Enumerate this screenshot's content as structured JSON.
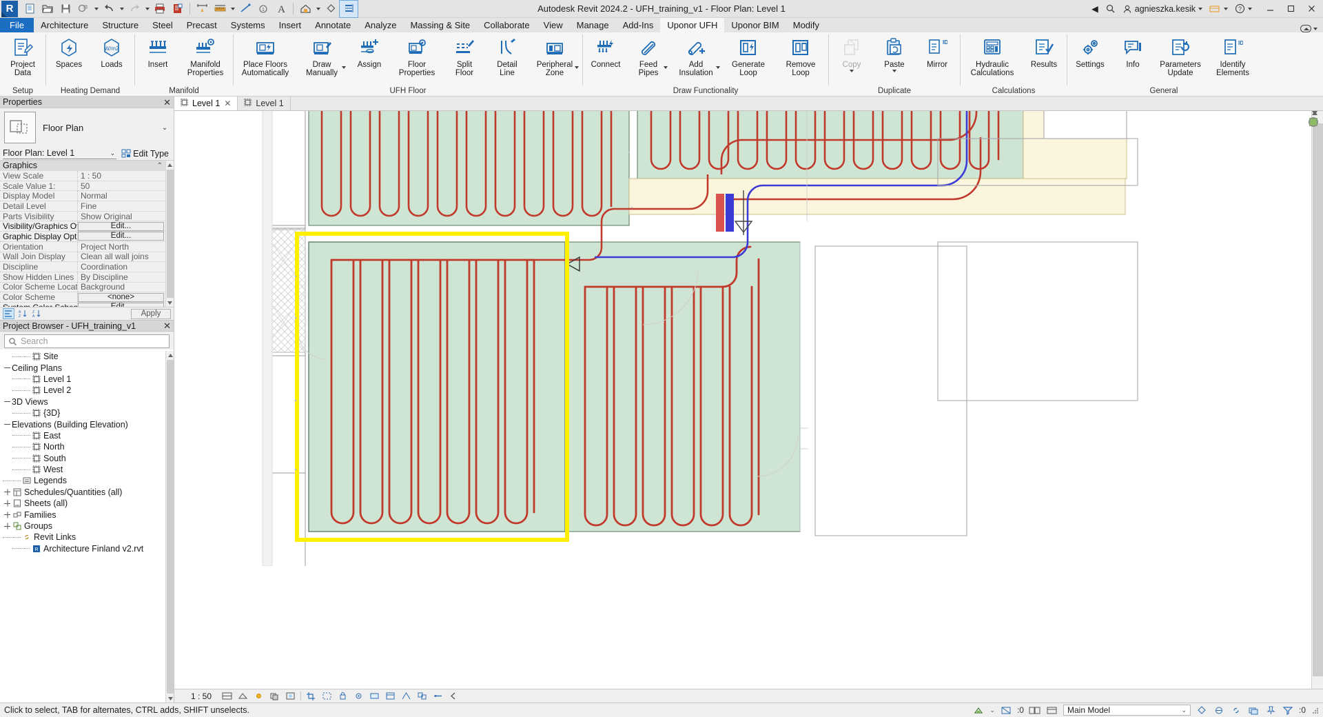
{
  "window": {
    "title": "Autodesk Revit 2024.2 - UFH_training_v1 - Floor Plan: Level 1",
    "user": "agnieszka.kesik",
    "minimize": "–",
    "maximize": "▭",
    "close": "✕"
  },
  "quick_access": {
    "logo": "R",
    "items": [
      "new-icon",
      "open-icon",
      "save-icon",
      "save-as-icon",
      "undo-icon",
      "redo-icon",
      "print-icon",
      "print-preview-icon",
      "measure-icon",
      "aligned-dimension-icon",
      "tag-icon",
      "keynote-icon",
      "text-icon",
      "default-3d-view-icon",
      "section-icon",
      "thin-lines-icon"
    ]
  },
  "tabs": {
    "file": "File",
    "items": [
      "Architecture",
      "Structure",
      "Steel",
      "Precast",
      "Systems",
      "Insert",
      "Annotate",
      "Analyze",
      "Massing & Site",
      "Collaborate",
      "View",
      "Manage",
      "Add-Ins",
      "Uponor UFH",
      "Uponor BIM",
      "Modify"
    ],
    "active": "Uponor UFH"
  },
  "ribbon": {
    "panels": [
      {
        "title": "Setup",
        "buttons": [
          {
            "label": "Project\nData",
            "icon": "project-data-icon",
            "dropdown": false,
            "disabled": false
          }
        ]
      },
      {
        "title": "Heating Demand",
        "buttons": [
          {
            "label": "Spaces",
            "icon": "spaces-icon",
            "dropdown": false,
            "disabled": false
          },
          {
            "label": "Loads",
            "icon": "loads-icon",
            "dropdown": false,
            "disabled": false
          }
        ]
      },
      {
        "title": "Manifold",
        "buttons": [
          {
            "label": "Insert",
            "icon": "insert-manifold-icon",
            "dropdown": false,
            "disabled": false
          },
          {
            "label": "Manifold\nProperties",
            "icon": "manifold-properties-icon",
            "dropdown": false,
            "disabled": false
          }
        ]
      },
      {
        "title": "UFH Floor",
        "buttons": [
          {
            "label": "Place Floors\nAutomatically",
            "icon": "place-floors-icon",
            "dropdown": false,
            "disabled": false
          },
          {
            "label": "Draw\nManually",
            "icon": "draw-manually-icon",
            "dropdown": true,
            "disabled": false
          },
          {
            "label": "Assign",
            "icon": "assign-icon",
            "dropdown": false,
            "disabled": false
          },
          {
            "label": "Floor\nProperties",
            "icon": "floor-properties-icon",
            "dropdown": false,
            "disabled": false
          },
          {
            "label": "Split\nFloor",
            "icon": "split-floor-icon",
            "dropdown": false,
            "disabled": false
          },
          {
            "label": "Detail\nLine",
            "icon": "detail-line-icon",
            "dropdown": false,
            "disabled": false
          },
          {
            "label": "Peripheral\nZone",
            "icon": "peripheral-zone-icon",
            "dropdown": true,
            "disabled": false
          }
        ]
      },
      {
        "title": "Draw Functionality",
        "buttons": [
          {
            "label": "Connect",
            "icon": "connect-icon",
            "dropdown": false,
            "disabled": false
          },
          {
            "label": "Feed\nPipes",
            "icon": "feed-pipes-icon",
            "dropdown": true,
            "disabled": false
          },
          {
            "label": "Add\nInsulation",
            "icon": "add-insulation-icon",
            "dropdown": true,
            "disabled": false
          },
          {
            "label": "Generate\nLoop",
            "icon": "generate-loop-icon",
            "dropdown": false,
            "disabled": false
          },
          {
            "label": "Remove\nLoop",
            "icon": "remove-loop-icon",
            "dropdown": false,
            "disabled": false
          }
        ]
      },
      {
        "title": "Duplicate",
        "buttons": [
          {
            "label": "Copy",
            "icon": "copy-icon",
            "dropdown": true,
            "disabled": true
          },
          {
            "label": "Paste",
            "icon": "paste-icon",
            "dropdown": true,
            "disabled": false
          },
          {
            "label": "Mirror",
            "icon": "mirror-icon",
            "dropdown": false,
            "disabled": false
          }
        ]
      },
      {
        "title": "Calculations",
        "buttons": [
          {
            "label": "Hydraulic\nCalculations",
            "icon": "hydraulic-calculations-icon",
            "dropdown": false,
            "disabled": false
          },
          {
            "label": "Results",
            "icon": "results-icon",
            "dropdown": false,
            "disabled": false
          }
        ]
      },
      {
        "title": "General",
        "buttons": [
          {
            "label": "Settings",
            "icon": "settings-icon",
            "dropdown": false,
            "disabled": false
          },
          {
            "label": "Info",
            "icon": "info-icon",
            "dropdown": false,
            "disabled": false
          },
          {
            "label": "Parameters\nUpdate",
            "icon": "parameters-update-icon",
            "dropdown": false,
            "disabled": false
          },
          {
            "label": "Identify\nElements",
            "icon": "identify-elements-icon",
            "dropdown": false,
            "disabled": false
          }
        ]
      }
    ]
  },
  "properties": {
    "header": "Properties",
    "type_name": "Floor Plan",
    "selector": "Floor Plan: Level 1",
    "edit_type": "Edit Type",
    "group": "Graphics",
    "rows": [
      {
        "key": "View Scale",
        "value": "1 : 50",
        "kind": "text",
        "bold": false
      },
      {
        "key": "Scale Value    1:",
        "value": "50",
        "kind": "text",
        "bold": false
      },
      {
        "key": "Display Model",
        "value": "Normal",
        "kind": "text",
        "bold": false
      },
      {
        "key": "Detail Level",
        "value": "Fine",
        "kind": "text",
        "bold": false
      },
      {
        "key": "Parts Visibility",
        "value": "Show Original",
        "kind": "text",
        "bold": false
      },
      {
        "key": "Visibility/Graphics Ove...",
        "value": "Edit...",
        "kind": "button",
        "bold": true
      },
      {
        "key": "Graphic Display Options",
        "value": "Edit...",
        "kind": "button",
        "bold": true
      },
      {
        "key": "Orientation",
        "value": "Project North",
        "kind": "text",
        "bold": false
      },
      {
        "key": "Wall Join Display",
        "value": "Clean all wall joins",
        "kind": "text",
        "bold": false
      },
      {
        "key": "Discipline",
        "value": "Coordination",
        "kind": "text",
        "bold": false
      },
      {
        "key": "Show Hidden Lines",
        "value": "By Discipline",
        "kind": "text",
        "bold": false
      },
      {
        "key": "Color Scheme Location",
        "value": "Background",
        "kind": "text",
        "bold": false
      },
      {
        "key": "Color Scheme",
        "value": "<none>",
        "kind": "button",
        "bold": false
      },
      {
        "key": "System Color Schemes",
        "value": "Edit...",
        "kind": "button",
        "bold": true
      }
    ],
    "apply": "Apply",
    "toolbar_icons": [
      "group-by-category-icon",
      "sort-ascending-icon",
      "sort-descending-icon"
    ]
  },
  "project_browser": {
    "header": "Project Browser - UFH_training_v1",
    "search_placeholder": "Search",
    "nodes": [
      {
        "label": "Site",
        "depth": 2,
        "toggle": "none",
        "icon": "view-icon"
      },
      {
        "label": "Ceiling Plans",
        "depth": 1,
        "toggle": "minus",
        "icon": "none"
      },
      {
        "label": "Level 1",
        "depth": 2,
        "toggle": "none",
        "icon": "view-icon"
      },
      {
        "label": "Level 2",
        "depth": 2,
        "toggle": "none",
        "icon": "view-icon"
      },
      {
        "label": "3D Views",
        "depth": 1,
        "toggle": "minus",
        "icon": "none"
      },
      {
        "label": "{3D}",
        "depth": 2,
        "toggle": "none",
        "icon": "view-icon"
      },
      {
        "label": "Elevations (Building Elevation)",
        "depth": 1,
        "toggle": "minus",
        "icon": "none"
      },
      {
        "label": "East",
        "depth": 2,
        "toggle": "none",
        "icon": "view-icon"
      },
      {
        "label": "North",
        "depth": 2,
        "toggle": "none",
        "icon": "view-icon"
      },
      {
        "label": "South",
        "depth": 2,
        "toggle": "none",
        "icon": "view-icon"
      },
      {
        "label": "West",
        "depth": 2,
        "toggle": "none",
        "icon": "view-icon"
      },
      {
        "label": "Legends",
        "depth": 1,
        "toggle": "none",
        "icon": "legend-icon"
      },
      {
        "label": "Schedules/Quantities (all)",
        "depth": 1,
        "toggle": "plus",
        "icon": "schedule-icon"
      },
      {
        "label": "Sheets (all)",
        "depth": 1,
        "toggle": "plus",
        "icon": "sheet-icon"
      },
      {
        "label": "Families",
        "depth": 1,
        "toggle": "plus",
        "icon": "family-icon"
      },
      {
        "label": "Groups",
        "depth": 1,
        "toggle": "plus",
        "icon": "group-icon"
      },
      {
        "label": "Revit Links",
        "depth": 1,
        "toggle": "none",
        "icon": "link-icon"
      },
      {
        "label": "Architecture Finland v2.rvt",
        "depth": 2,
        "toggle": "none",
        "icon": "rvt-icon"
      }
    ]
  },
  "view_tabs": [
    {
      "label": "Level 1",
      "active": true,
      "closable": true,
      "icon": "view-tab-icon"
    },
    {
      "label": "Level 1",
      "active": false,
      "closable": false,
      "icon": "view-tab-icon"
    }
  ],
  "view_control_bar": {
    "scale": "1 : 50",
    "icons": [
      "detail-level-icon",
      "visual-style-icon",
      "sun-path-icon",
      "shadows-icon",
      "render-icon",
      "crop-view-icon",
      "show-crop-icon",
      "lock-3d-view-icon",
      "temporary-hide-isolate-icon",
      "reveal-hidden-icon",
      "temporary-view-properties-icon",
      "show-analytical-model-icon",
      "highlight-displacement-sets-icon",
      "reveal-constraints-icon",
      "expand-view-bar-icon"
    ]
  },
  "status_bar": {
    "hint": "Click to select, TAB for alternates, CTRL adds, SHIFT unselects.",
    "worksets_label": "Main Model",
    "filter_count": ":0",
    "selection_count": ":0",
    "right_icons": [
      "design-options-icon",
      "exclude-options-icon",
      "active-only-icon",
      "constraints-icon",
      "selection-link-icon",
      "underlay-icon",
      "pinned-icon"
    ]
  },
  "drawing": {
    "colors": {
      "floor_fill": "#cfe5d4",
      "floor_stroke": "#6a8a72",
      "pipe_red": "#c0392b",
      "pipe_blue": "#3b3bd6",
      "selection_yellow": "#ffef00",
      "manifold_room_fill": "#faf5dc",
      "wall_gray": "#b8b8b8"
    },
    "selected_zone_label": "selected-floor-zone"
  }
}
